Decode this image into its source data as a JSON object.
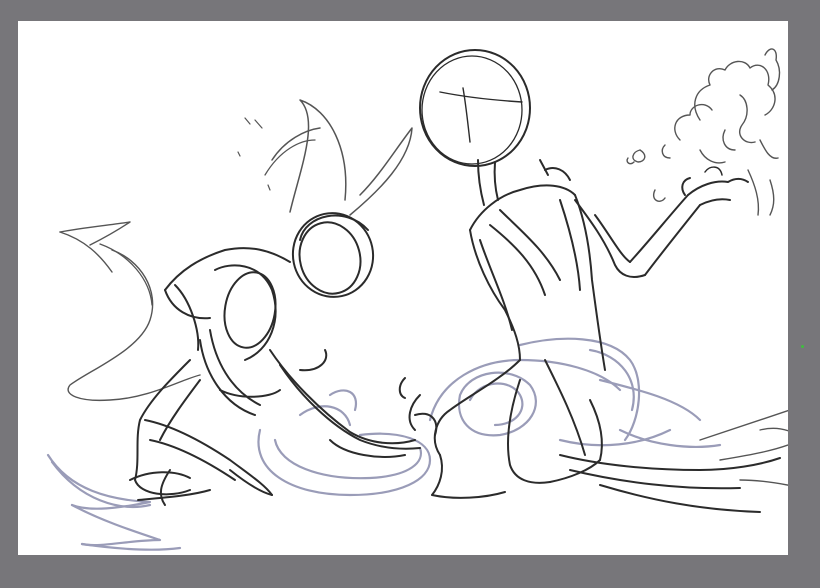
{
  "app": {
    "workspace_color": "#77767a",
    "canvas_color": "#ffffff",
    "cursor_color": "#3fbf3f"
  },
  "layers": [
    {
      "name": "sketch-line-layer",
      "ink_color": "#2b2b2b"
    },
    {
      "name": "blue-sketch-layer",
      "ink_color": "#9a9cb8"
    }
  ]
}
